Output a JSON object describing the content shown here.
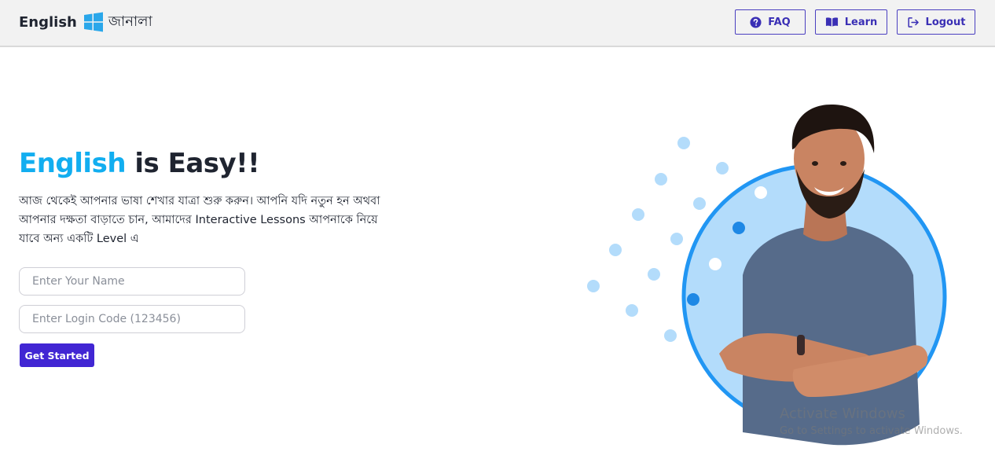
{
  "header": {
    "brand_text": "English",
    "brand_suffix": "জানালা",
    "nav": {
      "faq_label": "FAQ",
      "learn_label": "Learn",
      "logout_label": "Logout"
    }
  },
  "hero": {
    "title_accent": "English",
    "title_rest": " is Easy!!",
    "description": "আজ থেকেই আপনার ভাষা শেখার যাত্রা শুরু করুন। আপনি যদি নতুন হন অথবা আপনার দক্ষতা বাড়াতে চান, আমাদের Interactive Lessons আপনাকে নিয়ে যাবে অন্য একটি Level এ"
  },
  "form": {
    "name_placeholder": "Enter Your Name",
    "code_placeholder": "Enter Login Code (123456)",
    "submit_label": "Get Started"
  },
  "watermark": {
    "title": "Activate Windows",
    "subtitle": "Go to Settings to activate Windows."
  },
  "colors": {
    "accent": "#12aef0",
    "primary": "#4126d3",
    "ring": "#2196f3",
    "circle_fill": "#b3dcfb"
  },
  "icons": {
    "brand": "windows-logo-icon",
    "faq": "question-circle-icon",
    "learn": "book-open-icon",
    "logout": "logout-arrow-icon"
  }
}
